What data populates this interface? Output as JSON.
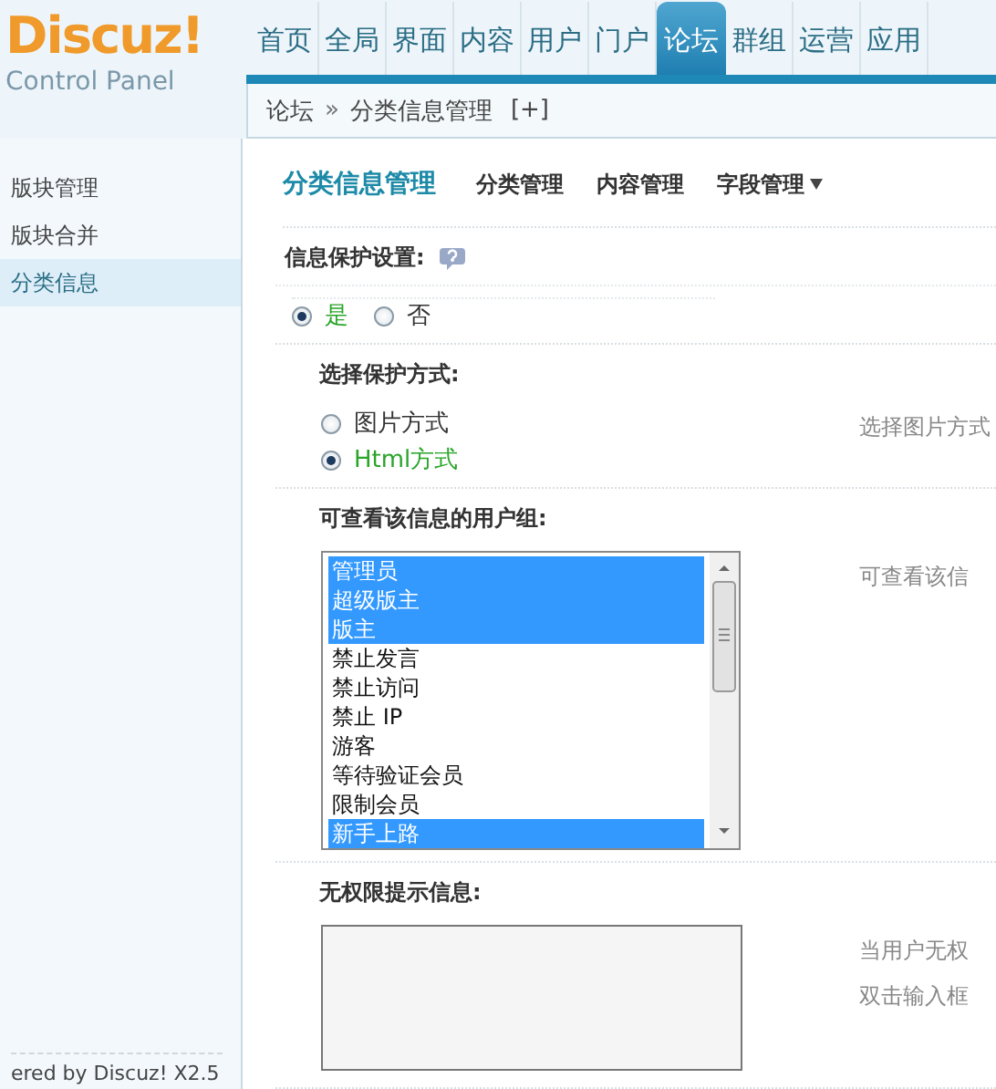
{
  "header": {
    "logo": "Discuz!",
    "subtitle": "Control Panel",
    "nav": [
      {
        "label": "首页",
        "selected": false
      },
      {
        "label": "全局",
        "selected": false
      },
      {
        "label": "界面",
        "selected": false
      },
      {
        "label": "内容",
        "selected": false
      },
      {
        "label": "用户",
        "selected": false
      },
      {
        "label": "门户",
        "selected": false
      },
      {
        "label": "论坛",
        "selected": true
      },
      {
        "label": "群组",
        "selected": false
      },
      {
        "label": "运营",
        "selected": false
      },
      {
        "label": "应用",
        "selected": false
      }
    ],
    "breadcrumb": {
      "items": [
        "论坛",
        "分类信息管理"
      ],
      "separator": "»",
      "toggle": "[+]"
    }
  },
  "sidebar": {
    "items": [
      {
        "label": "版块管理",
        "selected": false
      },
      {
        "label": "版块合并",
        "selected": false
      },
      {
        "label": "分类信息",
        "selected": true
      }
    ],
    "footer": "ered by Discuz! X2.5"
  },
  "main": {
    "title": "分类信息管理",
    "subnav": [
      {
        "label": "分类管理",
        "kind": "link"
      },
      {
        "label": "内容管理",
        "kind": "link"
      },
      {
        "label": "字段管理",
        "kind": "dropdown"
      }
    ],
    "settings": [
      {
        "kind": "radio_inline",
        "label": "信息保护设置:",
        "help": true,
        "options": [
          {
            "label": "是",
            "selected": true
          },
          {
            "label": "否",
            "selected": false
          }
        ]
      },
      {
        "kind": "radio_stacked",
        "label": "选择保护方式:",
        "indented": true,
        "hint": [
          "选择图片方式"
        ],
        "options": [
          {
            "label": "图片方式",
            "selected": false
          },
          {
            "label": "Html方式",
            "selected": true
          }
        ]
      },
      {
        "kind": "listbox",
        "label": "可查看该信息的用户组:",
        "indented": true,
        "hint": [
          "可查看该信"
        ],
        "options": [
          {
            "label": "管理员",
            "selected": true
          },
          {
            "label": "超级版主",
            "selected": true
          },
          {
            "label": "版主",
            "selected": true
          },
          {
            "label": "禁止发言",
            "selected": false
          },
          {
            "label": "禁止访问",
            "selected": false
          },
          {
            "label": "禁止 IP",
            "selected": false
          },
          {
            "label": "游客",
            "selected": false
          },
          {
            "label": "等待验证会员",
            "selected": false
          },
          {
            "label": "限制会员",
            "selected": false
          },
          {
            "label": "新手上路",
            "selected": true
          }
        ]
      },
      {
        "kind": "textarea",
        "label": "无权限提示信息:",
        "indented": true,
        "hint": [
          "当用户无权",
          "双击输入框"
        ]
      }
    ]
  }
}
